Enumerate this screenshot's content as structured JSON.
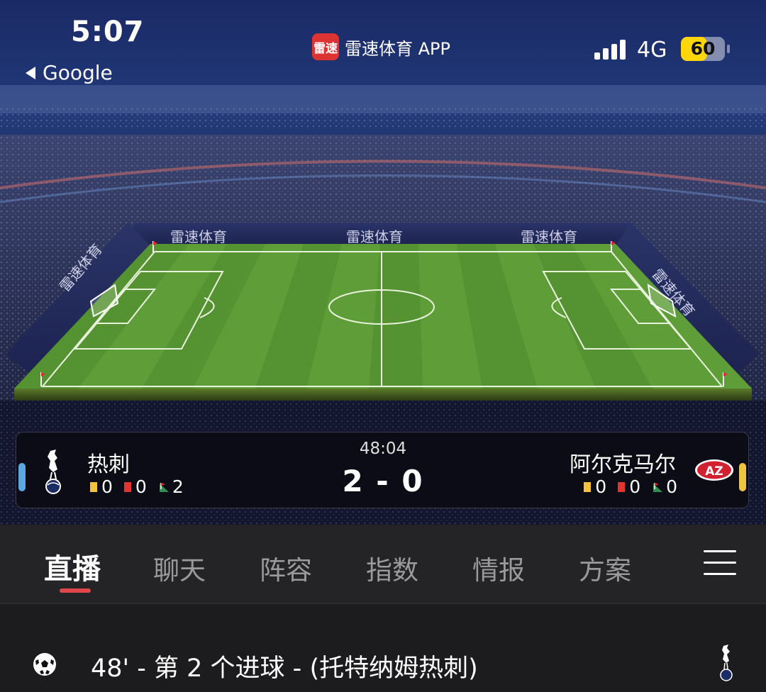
{
  "status_bar": {
    "time": "5:07",
    "back_label": "Google",
    "app_badge_logo_text": "雷速",
    "app_badge_label": "雷速体育 APP",
    "network": "4G",
    "battery_level": "60",
    "signal_bars": 4,
    "icons": [
      "back-arrow-icon",
      "signal-icon",
      "battery-icon"
    ]
  },
  "pitch": {
    "ad_boards": [
      "雷速体育",
      "雷速体育",
      "雷速体育",
      "雷速体育",
      "雷速体育"
    ],
    "colors": {
      "grass_light": "#6aa842",
      "grass_dark": "#4d8a2c",
      "sky": "#0f1a44"
    }
  },
  "match": {
    "time": "48:04",
    "score": "2 - 0",
    "home": {
      "name": "热刺",
      "yellow_cards": "0",
      "red_cards": "0",
      "corners": "2",
      "logo_icon": "tottenham-cockerel-icon",
      "side_color": "#5aa7e6"
    },
    "away": {
      "name": "阿尔克马尔",
      "yellow_cards": "0",
      "red_cards": "0",
      "corners": "0",
      "logo_icon": "az-alkmaar-logo-icon",
      "side_color": "#f0c340"
    }
  },
  "tabs": [
    {
      "label": "直播",
      "active": true
    },
    {
      "label": "聊天"
    },
    {
      "label": "阵容"
    },
    {
      "label": "指数"
    },
    {
      "label": "情报"
    },
    {
      "label": "方案"
    }
  ],
  "tab_accent": "#e0474c",
  "events": [
    {
      "text": "48' - 第 2 个进球 - (托特纳姆热刺)",
      "icon": "soccer-ball-icon",
      "team_icon": "tottenham-cockerel-icon"
    }
  ]
}
